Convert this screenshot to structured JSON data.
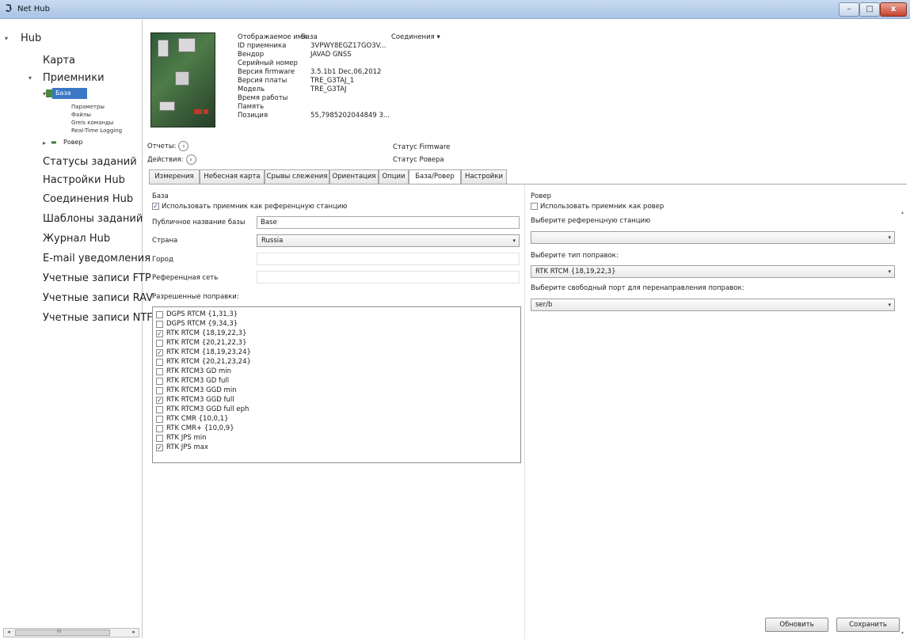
{
  "window": {
    "title": "Net Hub",
    "controls": {
      "minimize": "–",
      "maximize": "□",
      "close": "x"
    }
  },
  "sidebar": {
    "root": "Hub",
    "items": [
      {
        "label": "Карта"
      },
      {
        "label": "Приемники"
      },
      {
        "label": "База"
      },
      {
        "label": "Параметры"
      },
      {
        "label": "Файлы"
      },
      {
        "label": "Greis команды"
      },
      {
        "label": "Real-Time Logging"
      },
      {
        "label": "Ровер"
      },
      {
        "label": "Статусы заданий"
      },
      {
        "label": "Настройки Hub"
      },
      {
        "label": "Соединения Hub"
      },
      {
        "label": "Шаблоны заданий"
      },
      {
        "label": "Журнал Hub"
      },
      {
        "label": "E-mail уведомления"
      },
      {
        "label": "Учетные записи FTP"
      },
      {
        "label": "Учетные записи RAV"
      },
      {
        "label": "Учетные записи NTF"
      }
    ],
    "scroll_label": "III"
  },
  "receiver": {
    "display_name_label": "Отображаемое имя",
    "display_name_value": "База",
    "id_label": "ID приемника",
    "id_value": "3VPWY8EGZ17GO3V...",
    "vendor_label": "Вендор",
    "vendor_value": "JAVAD GNSS",
    "serial_label": "Серийный номер",
    "firmware_label": "Версия firmware",
    "firmware_value": "3.5.1b1 Dec,06,2012",
    "board_label": "Версия платы",
    "board_value": "TRE_G3TAJ_1",
    "model_label": "Модель",
    "model_value": "TRE_G3TAJ",
    "uptime_label": "Время работы",
    "memory_label": "Память",
    "position_label": "Позиция",
    "position_value": "55,7985202044849 3...",
    "connections_label": "Соединения ▾",
    "reports_label": "Отчеты:",
    "actions_label": "Действия:",
    "firmware_status_label": "Статус Firmware",
    "rover_status_label": "Статус Ровера"
  },
  "tabs": [
    {
      "label": "Измерения"
    },
    {
      "label": "Небесная карта"
    },
    {
      "label": "Срывы слежения"
    },
    {
      "label": "Ориентация"
    },
    {
      "label": "Опции"
    },
    {
      "label": "База/Ровер"
    },
    {
      "label": "Настройки"
    }
  ],
  "base": {
    "section_title": "База",
    "use_as_reference_label": "Использовать приемник как референцную станцию",
    "public_name_label": "Публичное название базы",
    "public_name_value": "Base",
    "country_label": "Страна",
    "country_value": "Russia",
    "city_label": "Город",
    "network_label": "Референцная сеть",
    "allowed_corrections_label": "Разрешенные поправки:",
    "corrections": [
      {
        "label": "DGPS RTCM {1,31,3}",
        "checked": false
      },
      {
        "label": "DGPS RTCM {9,34,3}",
        "checked": false
      },
      {
        "label": "RTK RTCM {18,19,22,3}",
        "checked": true
      },
      {
        "label": "RTK RTCM {20,21,22,3}",
        "checked": false
      },
      {
        "label": "RTK RTCM {18,19,23,24}",
        "checked": true
      },
      {
        "label": "RTK RTCM {20,21,23,24}",
        "checked": false
      },
      {
        "label": "RTK RTCM3 GD min",
        "checked": false
      },
      {
        "label": "RTK RTCM3 GD full",
        "checked": false
      },
      {
        "label": "RTK RTCM3 GGD min",
        "checked": false
      },
      {
        "label": "RTK RTCM3 GGD full",
        "checked": true
      },
      {
        "label": "RTK RTCM3 GGD full eph",
        "checked": false
      },
      {
        "label": "RTK CMR {10,0,1}",
        "checked": false
      },
      {
        "label": "RTK CMR+ {10,0,9}",
        "checked": false
      },
      {
        "label": "RTK JPS min",
        "checked": false
      },
      {
        "label": "RTK JPS max",
        "checked": true
      }
    ]
  },
  "rover": {
    "section_title": "Ровер",
    "use_as_rover_label": "Использовать приемник как ровер",
    "select_reference_label": "Выберите референцную станцию",
    "select_reference_value": "",
    "correction_type_label": "Выберите тип поправок:",
    "correction_type_value": "RTK RTCM {18,19,22,3}",
    "free_port_label": "Выберите свободный порт для перенаправления поправок:",
    "free_port_value": "ser/b"
  },
  "buttons": {
    "refresh": "Обновить",
    "save": "Сохранить"
  },
  "icons": {
    "checkmark": "✓",
    "dropdown": "▾",
    "circle_arrow": "›"
  }
}
